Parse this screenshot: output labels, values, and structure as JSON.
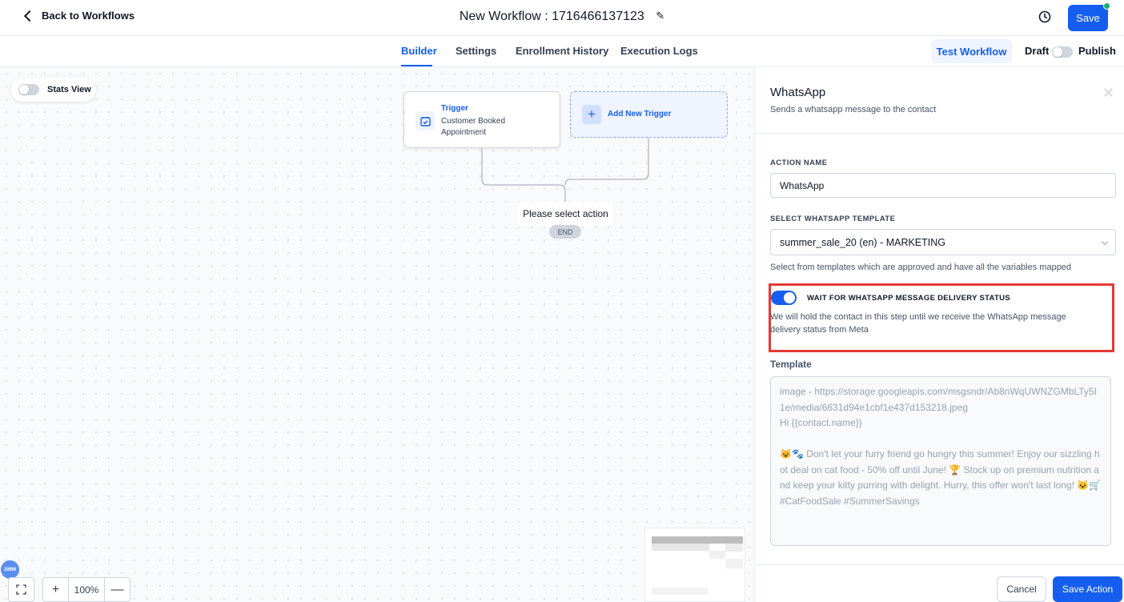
{
  "header": {
    "back_label": "Back to Workflows",
    "workflow_title": "New Workflow : 1716466137123",
    "save_label": "Save"
  },
  "tabs": [
    {
      "label": "Builder",
      "active": true
    },
    {
      "label": "Settings",
      "active": false
    },
    {
      "label": "Enrollment History",
      "active": false
    },
    {
      "label": "Execution Logs",
      "active": false
    }
  ],
  "toolbar": {
    "test_workflow_label": "Test Workflow",
    "draft_label": "Draft",
    "publish_label": "Publish",
    "publish_on": false
  },
  "canvas": {
    "stats_view_label": "Stats View",
    "stats_view_on": false,
    "trigger": {
      "title": "Trigger",
      "description": "Customer Booked Appointment"
    },
    "add_trigger_label": "Add New Trigger",
    "select_action_label": "Please select action",
    "end_label": "END",
    "badge_label": "289M",
    "zoom_value": "100%"
  },
  "panel": {
    "title": "WhatsApp",
    "subtitle": "Sends a whatsapp message to the contact",
    "action_name_label": "ACTION NAME",
    "action_name_value": "WhatsApp",
    "template_select_label": "SELECT WHATSAPP TEMPLATE",
    "template_select_value": "summer_sale_20 (en) - MARKETING",
    "template_hint": "Select from templates which are approved and have all the variables mapped",
    "wait_toggle_on": true,
    "wait_label": "WAIT FOR WHATSAPP MESSAGE DELIVERY STATUS",
    "wait_description": "We will hold the contact in this step until we receive the WhatsApp message delivery status from Meta",
    "template_label": "Template",
    "template_body": "image - https://storage.googleapis.com/msgsndr/Ab8nWqUWNZGMbLTy5I1e/media/6631d94e1cbf1e437d153218.jpeg\nHi {{contact.name}}\n\n😺🐾 Don't let your furry friend go hungry this summer! Enjoy our sizzling hot deal on cat food - 50% off until June! 🏆 Stock up on premium nutrition and keep your kitty purring with delight. Hurry, this offer won't last long! 🐱🛒 #CatFoodSale #SummerSavings",
    "cancel_label": "Cancel",
    "save_action_label": "Save Action"
  },
  "colors": {
    "accent": "#155eef",
    "highlight_border": "#e53935",
    "status_dot": "#17b26a"
  }
}
